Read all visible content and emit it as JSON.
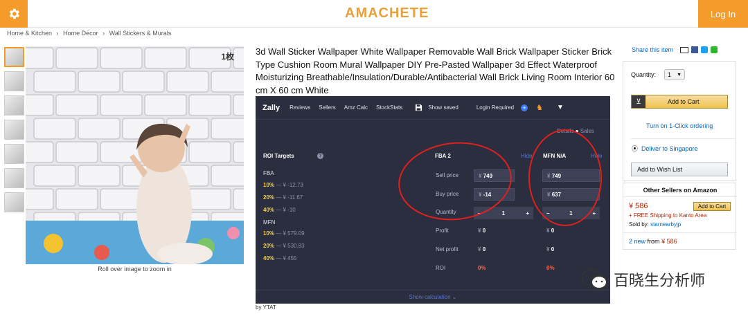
{
  "header": {
    "logo": "AMACHETE",
    "login": "Log In"
  },
  "breadcrumbs": [
    "Home & Kitchen",
    "›",
    "Home Décor",
    "›",
    "Wall Stickers & Murals"
  ],
  "image": {
    "badge": "1枚",
    "zoom_hint": "Roll over image to zoom in"
  },
  "product": {
    "title": "3d Wall Sticker Wallpaper White Wallpaper Removable Wall Brick Wallpaper Sticker Brick Type Cushion Room Mural Wallpaper DIY Pre-Pasted Wallpaper 3d Effect Waterproof Moisturizing Breathable/Insulation/Durable/Antibacterial Wall Brick Living Room Interior 60 cm X 60 cm White",
    "byline": "by YTAT"
  },
  "zally": {
    "brand": "Zally",
    "menu": [
      "Reviews",
      "Sellers",
      "Amz Calc",
      "StockStats",
      "Show saved",
      "Login Required"
    ],
    "tabs": {
      "details": "Details",
      "sales": "Sales"
    },
    "roi_title": "ROI Targets",
    "roi_help": "?",
    "fba_label": "FBA",
    "mfn_label": "MFN",
    "fba_rows": [
      {
        "pct": "10%",
        "val": "¥ -12.73"
      },
      {
        "pct": "20%",
        "val": "¥ -11.67"
      },
      {
        "pct": "40%",
        "val": "¥ -10"
      }
    ],
    "mfn_rows": [
      {
        "pct": "10%",
        "val": "¥ 579.09"
      },
      {
        "pct": "20%",
        "val": "¥ 530.83"
      },
      {
        "pct": "40%",
        "val": "¥ 455"
      }
    ],
    "dash": "—",
    "col1": {
      "title": "FBA 2",
      "action": "Hide",
      "sell": "749",
      "buy": "-14",
      "qty": "1",
      "profit": "0",
      "net": "0",
      "roi": "0%"
    },
    "col2": {
      "title": "MFN N/A",
      "action": "Hide",
      "sell": "749",
      "buy": "637",
      "qty": "1",
      "profit": "0",
      "net": "0",
      "roi": "0%"
    },
    "row_labels": {
      "sell": "Sell price",
      "buy": "Buy price",
      "qty": "Quantity",
      "profit": "Profit",
      "net": "Net profit",
      "roi": "ROI"
    },
    "yen": "¥",
    "minus": "–",
    "plus": "+",
    "footer": "Show calculation"
  },
  "share": {
    "label": "Share this item"
  },
  "buybox": {
    "qty_label": "Quantity:",
    "qty_value": "1",
    "add_to_cart": "Add to Cart",
    "one_click": "Turn on 1-Click ordering",
    "deliver": "Deliver to Singapore",
    "wishlist": "Add to Wish List"
  },
  "other_sellers": {
    "title": "Other Sellers on Amazon",
    "price": "¥ 586",
    "add": "Add to Cart",
    "shipping": "+ FREE Shipping to Kanto Area",
    "sold_by_label": "Sold by:",
    "seller": "starnearbyjp",
    "new_count": "2 new",
    "from": "from",
    "from_price": "¥ 586"
  },
  "watermark": {
    "text": "百晓生分析师"
  },
  "colors": {
    "accent": "#f39c2a",
    "panel": "#2b2e3e",
    "highlight": "#ffcf2e",
    "circle": "#e0201d"
  }
}
